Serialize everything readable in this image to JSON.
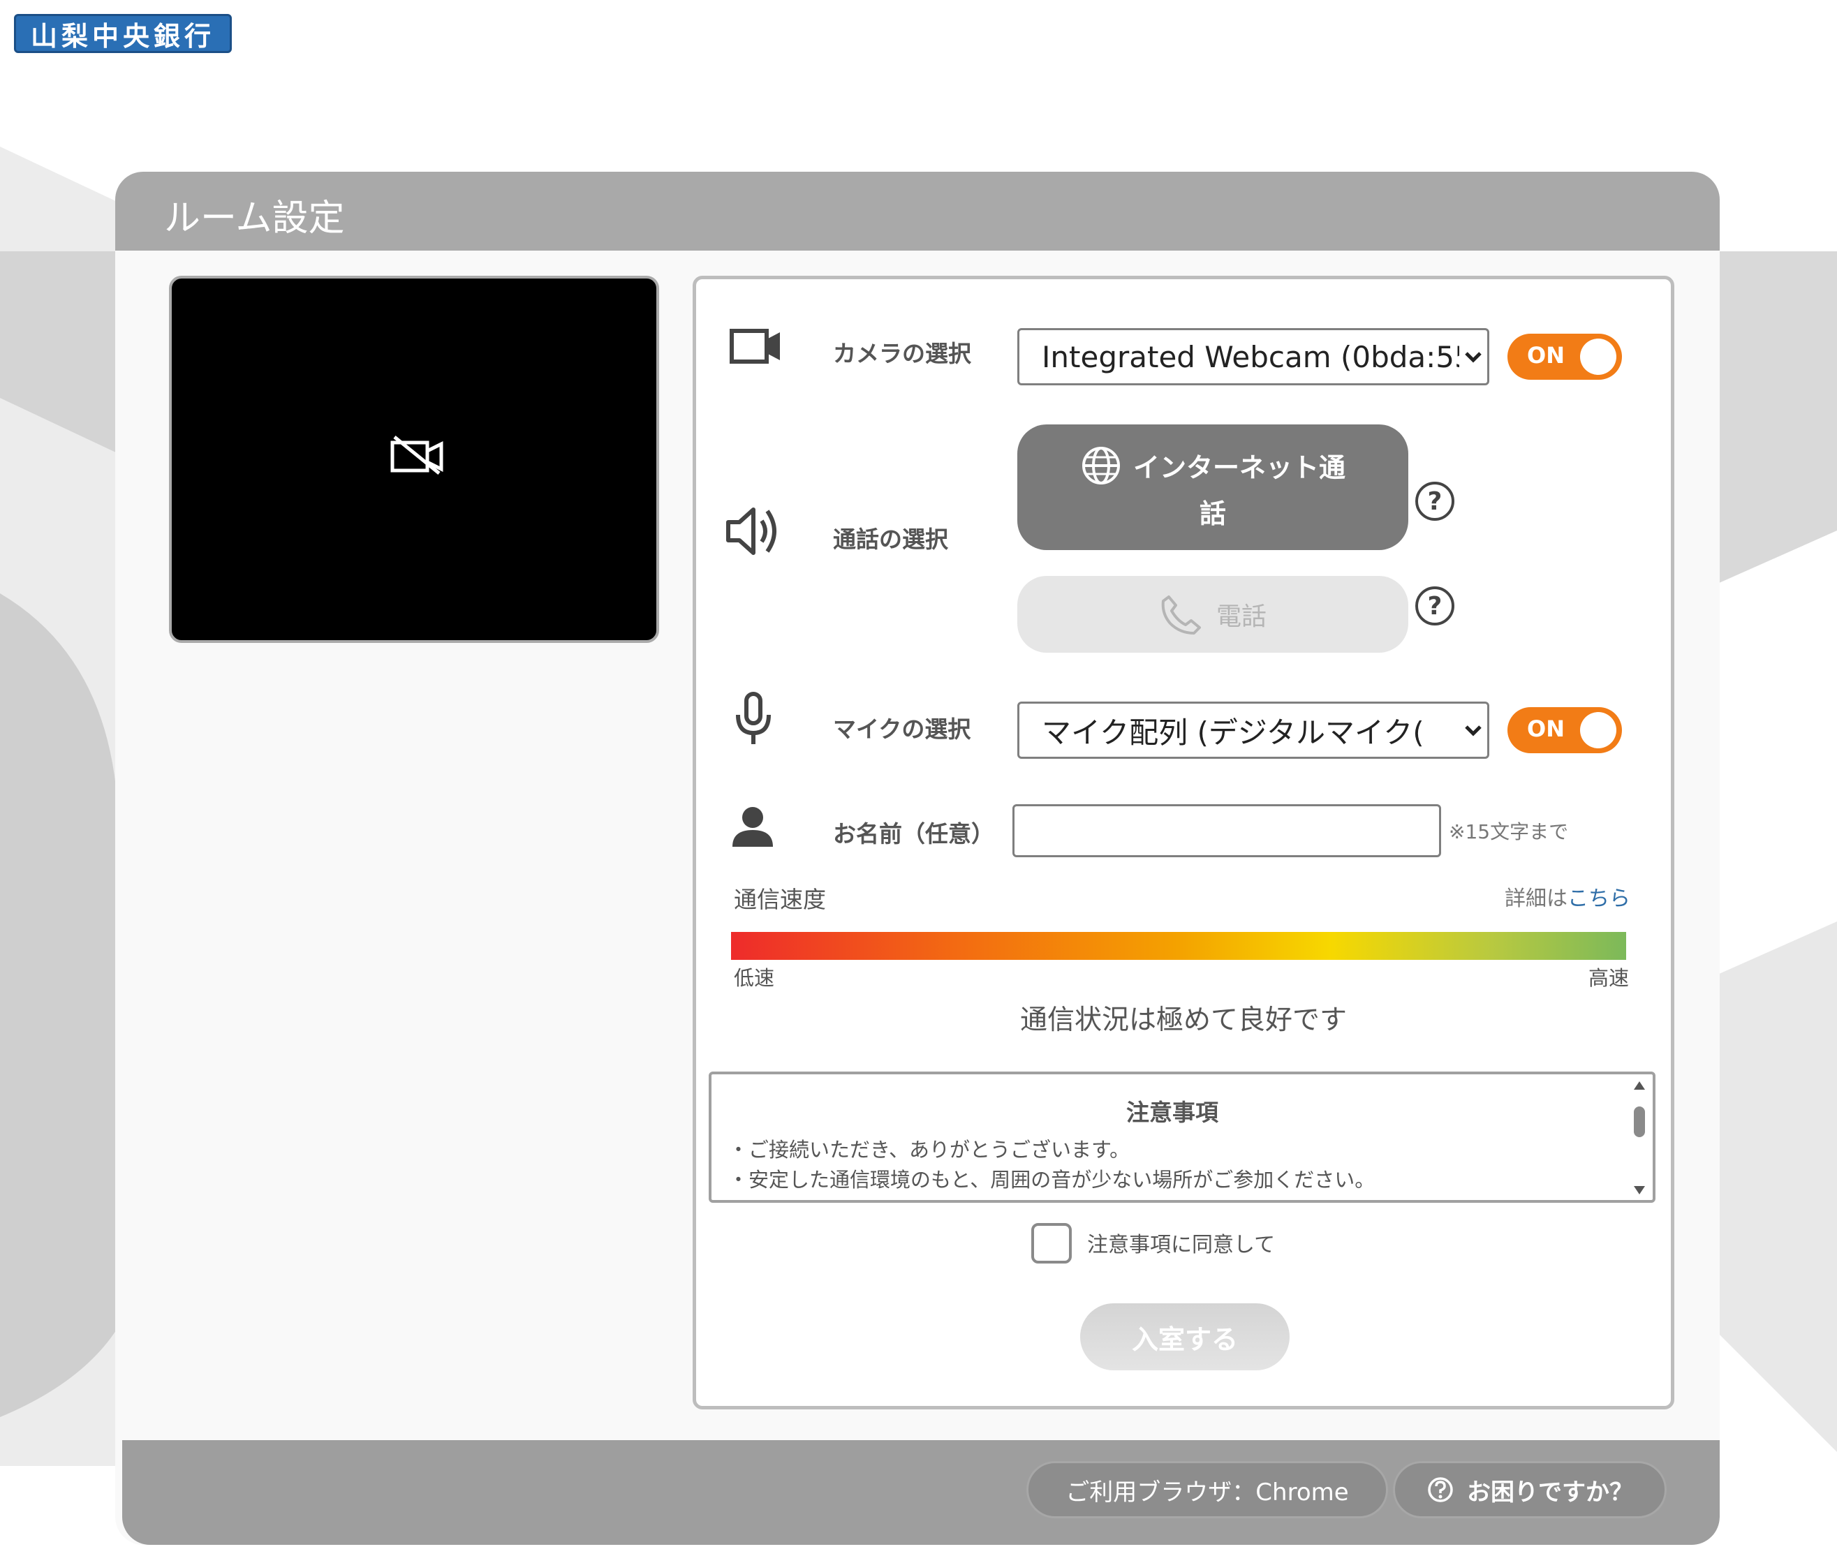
{
  "logo": {
    "text": "山梨中央銀行"
  },
  "card": {
    "title": "ルーム設定"
  },
  "camera": {
    "label": "カメラの選択",
    "selected": "Integrated Webcam (0bda:55",
    "toggle": "ON"
  },
  "call": {
    "label": "通話の選択",
    "internet_line1": "インターネット通",
    "internet_line2": "話",
    "phone": "電話",
    "help": "?"
  },
  "mic": {
    "label": "マイクの選択",
    "selected": "マイク配列 (デジタルマイク(",
    "toggle": "ON"
  },
  "name": {
    "label": "お名前（任意）",
    "value": "",
    "note": "※15文字まで"
  },
  "speed": {
    "label": "通信速度",
    "details_prefix": "詳細は",
    "details_link": "こちら",
    "low": "低速",
    "high": "高速",
    "status": "通信状況は極めて良好です"
  },
  "notice": {
    "title": "注意事項",
    "lines": [
      "・ご接続いただき、ありがとうございます。",
      "・安定した通信環境のもと、周囲の音が少ない場所がご参加ください。"
    ]
  },
  "agree": {
    "label": "注意事項に同意して"
  },
  "enter_button": "入室する",
  "footer": {
    "browser": "ご利用ブラウザ：Chrome",
    "help": "お困りですか？"
  },
  "colors": {
    "accent_orange": "#f27c16",
    "header_gray": "#a9a9a9",
    "link_blue": "#2f6ea8"
  }
}
